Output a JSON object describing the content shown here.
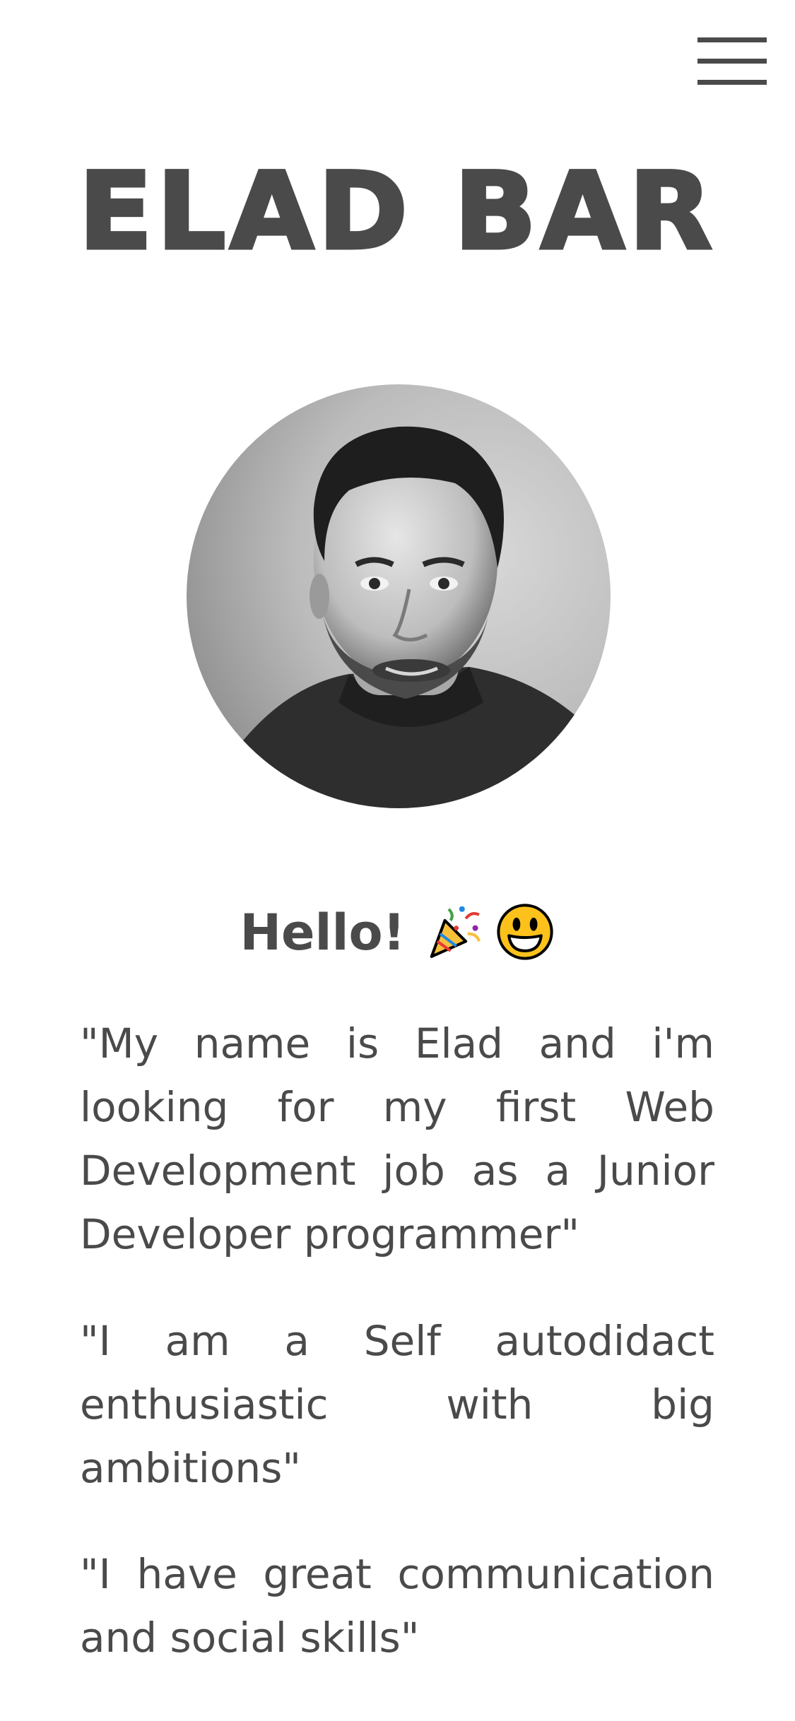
{
  "header": {
    "menu_icon": "hamburger-menu-icon",
    "title": "ELAD BAR"
  },
  "profile": {
    "photo_icon": "profile-photo"
  },
  "greeting": {
    "text": "Hello!",
    "emojis": [
      "party-popper-icon",
      "grinning-face-icon"
    ]
  },
  "about": {
    "paragraphs": [
      "\"My name is Elad and i'm looking for my first Web Development job as a Junior Developer programmer\"",
      "\"I am a Self autodidact enthusiastic with big ambitions\"",
      "\"I have great communication and social skills\""
    ]
  },
  "colors": {
    "text": "#4a4a4a",
    "background": "#ffffff"
  }
}
